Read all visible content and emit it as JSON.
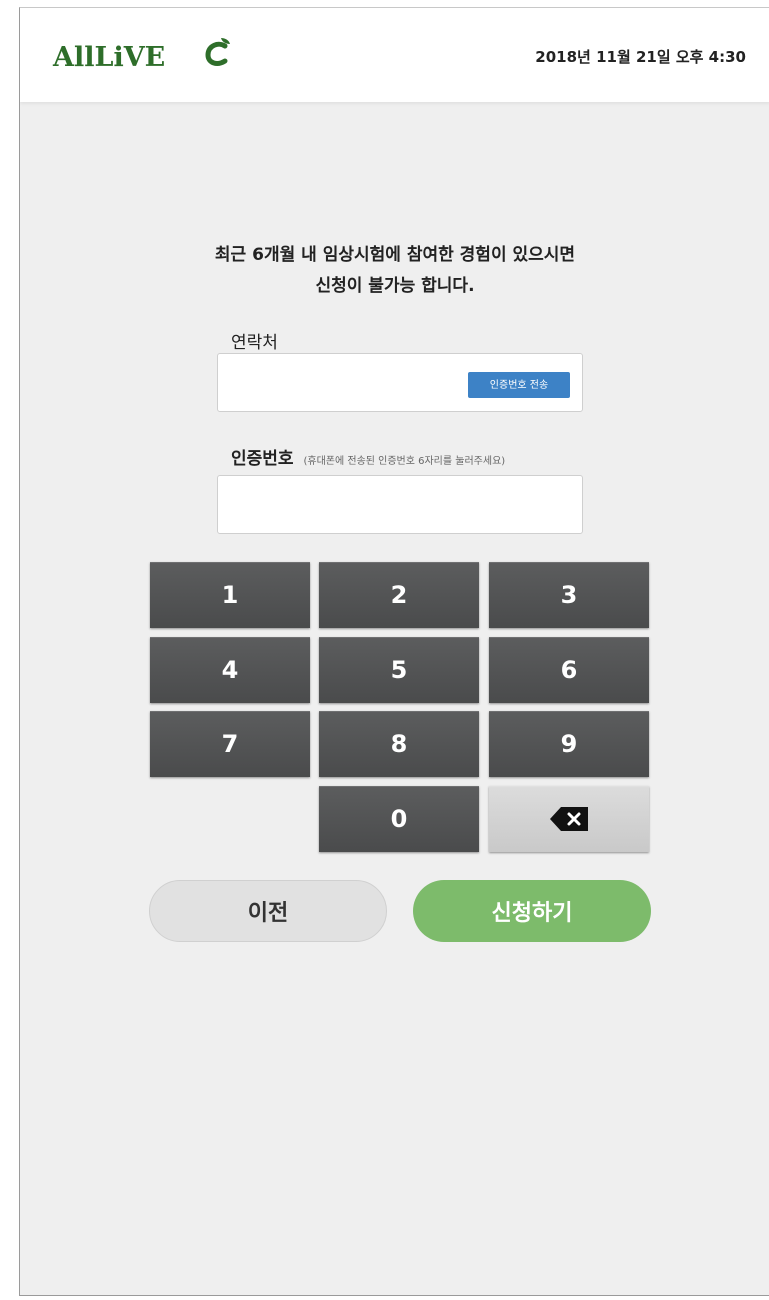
{
  "header": {
    "logo_text": "AllLiVE",
    "datetime": "2018년 11월 21일 오후 4:30"
  },
  "notice": {
    "line1": "최근 6개월 내 임상시험에 참여한 경험이 있으시면",
    "line2": "신청이 불가능 합니다."
  },
  "contact": {
    "label": "연락처",
    "value": "",
    "send_button": "인증번호 전송"
  },
  "verification": {
    "label": "인증번호",
    "hint": "(휴대폰에 전송된 인증번호 6자리를 눌러주세요)",
    "value": ""
  },
  "keypad": {
    "keys": [
      "1",
      "2",
      "3",
      "4",
      "5",
      "6",
      "7",
      "8",
      "9",
      "0"
    ],
    "delete_icon": "backspace-icon"
  },
  "actions": {
    "prev_label": "이전",
    "apply_label": "신청하기"
  },
  "colors": {
    "brand_green": "#2e6e2a",
    "apply_green": "#7dbb6b",
    "send_blue": "#3d82c6",
    "key_dark": "#505152"
  }
}
